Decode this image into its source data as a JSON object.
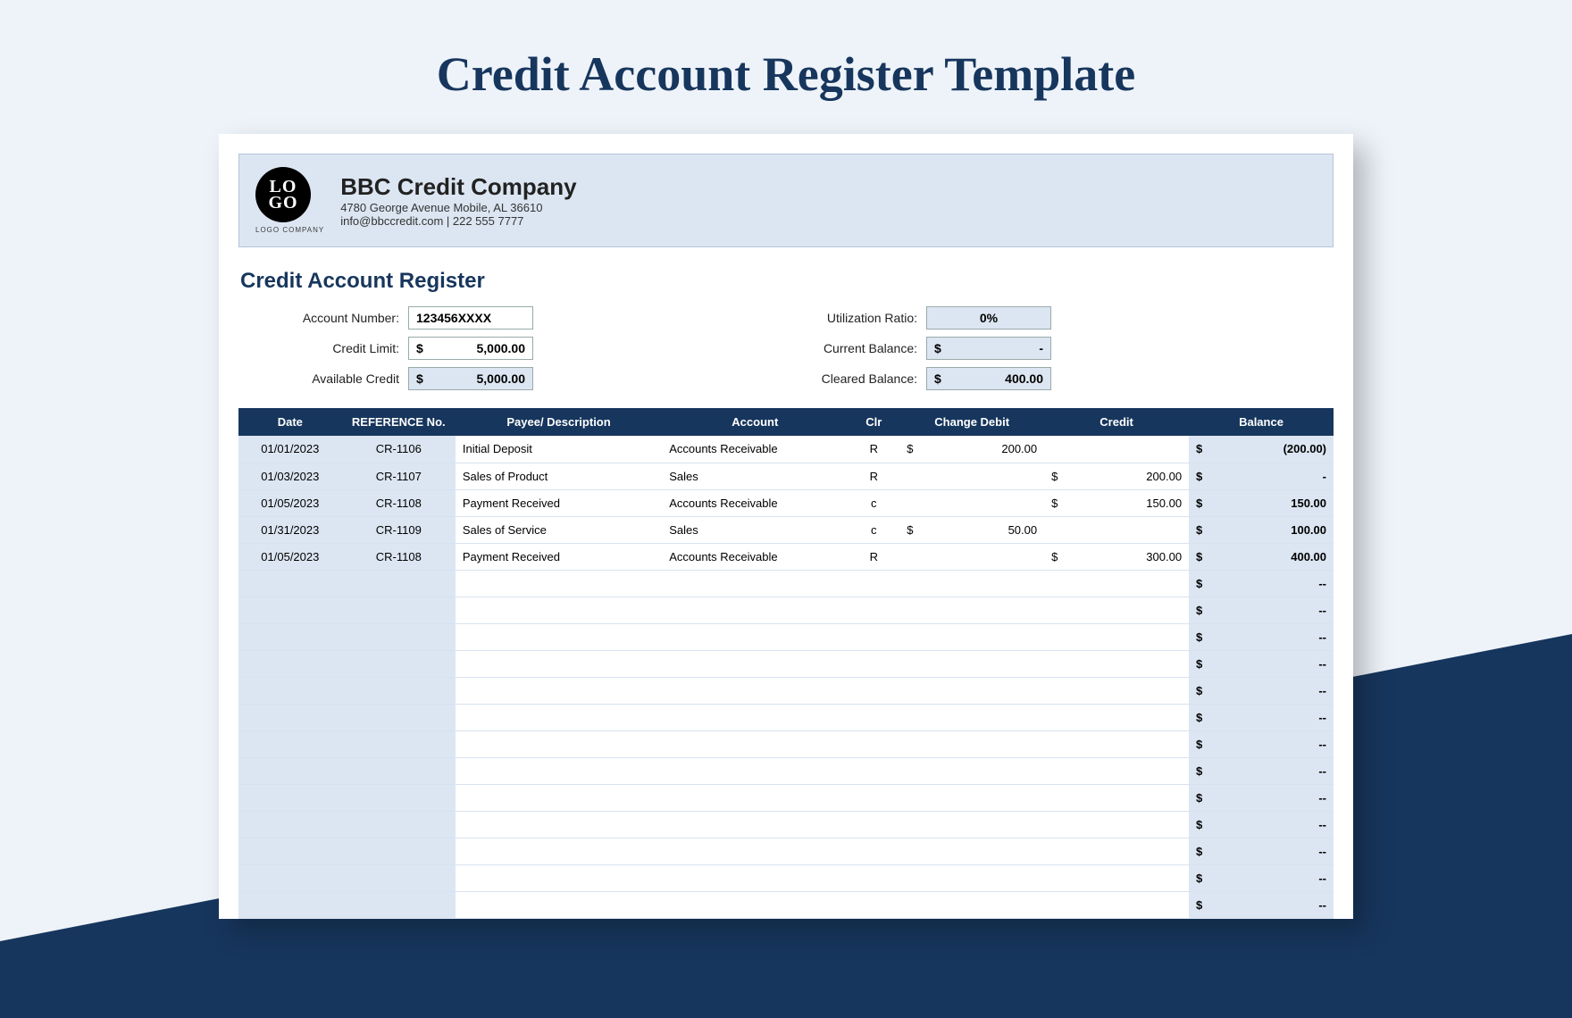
{
  "page_title": "Credit Account Register Template",
  "company": {
    "logo_top": "LO",
    "logo_bottom": "GO",
    "logo_subtext": "LOGO COMPANY",
    "name": "BBC Credit Company",
    "address": "4780 George Avenue Mobile, AL 36610",
    "contact": "info@bbccredit.com | 222 555 7777"
  },
  "section_title": "Credit Account Register",
  "meta_left": {
    "account_number_label": "Account Number:",
    "account_number_value": "123456XXXX",
    "credit_limit_label": "Credit Limit:",
    "credit_limit_value": "5,000.00",
    "available_credit_label": "Available Credit",
    "available_credit_value": "5,000.00"
  },
  "meta_right": {
    "utilization_label": "Utilization Ratio:",
    "utilization_value": "0%",
    "current_balance_label": "Current Balance:",
    "current_balance_value": "-",
    "cleared_balance_label": "Cleared Balance:",
    "cleared_balance_value": "400.00"
  },
  "columns": {
    "date": "Date",
    "ref": "REFERENCE No.",
    "desc": "Payee/ Description",
    "acct": "Account",
    "clr": "Clr",
    "debit": "Change Debit",
    "credit": "Credit",
    "balance": "Balance"
  },
  "rows": [
    {
      "date": "01/01/2023",
      "ref": "CR-1106",
      "desc": "Initial Deposit",
      "acct": "Accounts Receivable",
      "clr": "R",
      "debit": "200.00",
      "credit": "",
      "balance": "(200.00)"
    },
    {
      "date": "01/03/2023",
      "ref": "CR-1107",
      "desc": "Sales of Product",
      "acct": "Sales",
      "clr": "R",
      "debit": "",
      "credit": "200.00",
      "balance": "-"
    },
    {
      "date": "01/05/2023",
      "ref": "CR-1108",
      "desc": "Payment Received",
      "acct": "Accounts Receivable",
      "clr": "c",
      "debit": "",
      "credit": "150.00",
      "balance": "150.00"
    },
    {
      "date": "01/31/2023",
      "ref": "CR-1109",
      "desc": "Sales of Service",
      "acct": "Sales",
      "clr": "c",
      "debit": "50.00",
      "credit": "",
      "balance": "100.00"
    },
    {
      "date": "01/05/2023",
      "ref": "CR-1108",
      "desc": "Payment Received",
      "acct": "Accounts Receivable",
      "clr": "R",
      "debit": "",
      "credit": "300.00",
      "balance": "400.00"
    }
  ],
  "empty_rows": 13,
  "currency": "$"
}
